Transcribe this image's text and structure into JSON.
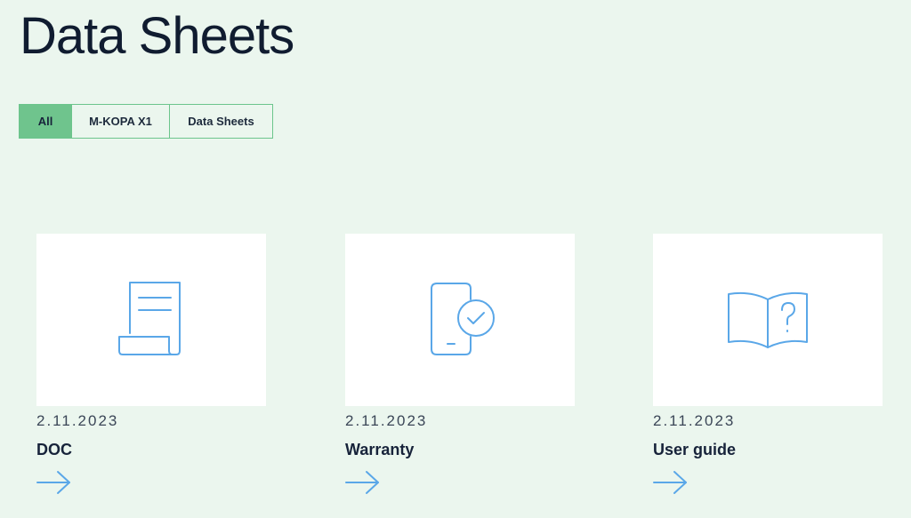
{
  "page": {
    "title": "Data Sheets"
  },
  "filters": {
    "tabs": [
      {
        "label": "All",
        "active": true
      },
      {
        "label": "M-KOPA X1",
        "active": false
      },
      {
        "label": "Data Sheets",
        "active": false
      }
    ]
  },
  "colors": {
    "background": "#ebf6ee",
    "accent_green": "#6fc48d",
    "icon_blue": "#5aa7e8"
  },
  "cards": [
    {
      "date": "2.11.2023",
      "title": "DOC",
      "icon": "document-scroll-icon"
    },
    {
      "date": "2.11.2023",
      "title": "Warranty",
      "icon": "phone-check-icon"
    },
    {
      "date": "2.11.2023",
      "title": "User guide",
      "icon": "book-question-icon"
    }
  ]
}
